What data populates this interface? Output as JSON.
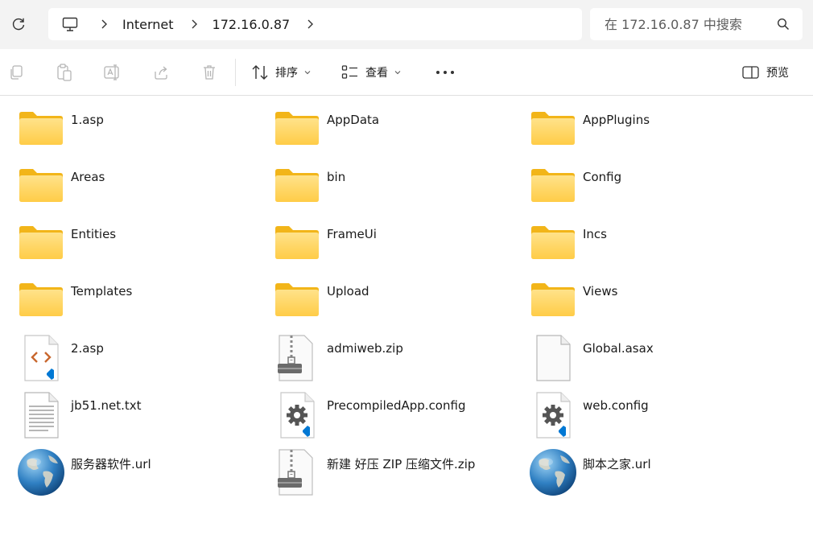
{
  "address": {
    "breadcrumbs": [
      "Internet",
      "172.16.0.87"
    ],
    "search_placeholder": "在 172.16.0.87 中搜索"
  },
  "toolbar": {
    "sort_label": "排序",
    "view_label": "查看",
    "preview_label": "预览"
  },
  "colors": {
    "folder_back": "#f2b519",
    "folder_front": "#ffd766",
    "accent": "#0067c0"
  },
  "files": [
    {
      "name": "1.asp",
      "icon": "folder-icon"
    },
    {
      "name": "AppData",
      "icon": "folder-icon"
    },
    {
      "name": "AppPlugins",
      "icon": "folder-icon"
    },
    {
      "name": "Areas",
      "icon": "folder-icon"
    },
    {
      "name": "bin",
      "icon": "folder-icon"
    },
    {
      "name": "Config",
      "icon": "folder-icon"
    },
    {
      "name": "Entities",
      "icon": "folder-icon"
    },
    {
      "name": "FrameUi",
      "icon": "folder-icon"
    },
    {
      "name": "Incs",
      "icon": "folder-icon"
    },
    {
      "name": "Templates",
      "icon": "folder-icon"
    },
    {
      "name": "Upload",
      "icon": "folder-icon"
    },
    {
      "name": "Views",
      "icon": "folder-icon"
    },
    {
      "name": "2.asp",
      "icon": "code-file-icon"
    },
    {
      "name": "admiweb.zip",
      "icon": "zip-file-icon"
    },
    {
      "name": "Global.asax",
      "icon": "blank-file-icon"
    },
    {
      "name": "jb51.net.txt",
      "icon": "text-file-icon"
    },
    {
      "name": "PrecompiledApp.config",
      "icon": "config-file-icon"
    },
    {
      "name": "web.config",
      "icon": "config-file-icon"
    },
    {
      "name": "服务器软件.url",
      "icon": "globe-icon"
    },
    {
      "name": "新建 好压 ZIP 压缩文件.zip",
      "icon": "zip-file-icon"
    },
    {
      "name": "脚本之家.url",
      "icon": "globe-icon"
    }
  ]
}
